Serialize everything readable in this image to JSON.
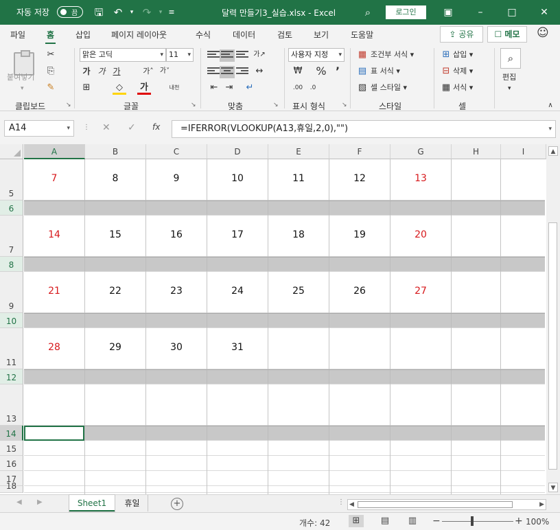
{
  "titlebar": {
    "autosave_label": "자동 저장",
    "autosave_state": "끔",
    "doc_title": "달력 만들기3_실습.xlsx  -  Excel",
    "login": "로그인"
  },
  "ribbon_tabs": [
    "파일",
    "홈",
    "삽입",
    "페이지 레이아웃",
    "수식",
    "데이터",
    "검토",
    "보기",
    "도움말"
  ],
  "share_label": "공유",
  "memo_label": "메모",
  "ribbon": {
    "paste_label": "붙여넣기",
    "font_name": "맑은 고딕",
    "font_size": "11",
    "number_format": "사용자 지정",
    "cond_format": "조건부 서식",
    "table_format": "표 서식",
    "cell_style": "셀 스타일",
    "insert": "삽입",
    "delete": "삭제",
    "format": "서식",
    "edit": "편집",
    "groups": [
      "클립보드",
      "글꼴",
      "맞춤",
      "표시 형식",
      "스타일",
      "셀"
    ]
  },
  "formula_bar": {
    "name_box": "A14",
    "formula": "=IFERROR(VLOOKUP(A13,휴일,2,0),\"\")",
    "fx": "fx"
  },
  "columns": [
    "A",
    "B",
    "C",
    "D",
    "E",
    "F",
    "G",
    "H",
    "I"
  ],
  "rows": [
    "5",
    "6",
    "7",
    "8",
    "9",
    "10",
    "11",
    "12",
    "13",
    "14",
    "15",
    "16",
    "17",
    "18"
  ],
  "calendar": {
    "week_rows": [
      [
        "7",
        "8",
        "9",
        "10",
        "11",
        "12",
        "13"
      ],
      [
        "14",
        "15",
        "16",
        "17",
        "18",
        "19",
        "20"
      ],
      [
        "21",
        "22",
        "23",
        "24",
        "25",
        "26",
        "27"
      ],
      [
        "28",
        "29",
        "30",
        "31",
        "",
        "",
        ""
      ]
    ],
    "weekend_color": "#d7191c"
  },
  "sheets": [
    "Sheet1",
    "휴일"
  ],
  "status": {
    "count": "개수: 42",
    "zoom": "100%"
  },
  "colors": {
    "excel_green": "#217346",
    "band_gray": "#c8c8c8"
  }
}
